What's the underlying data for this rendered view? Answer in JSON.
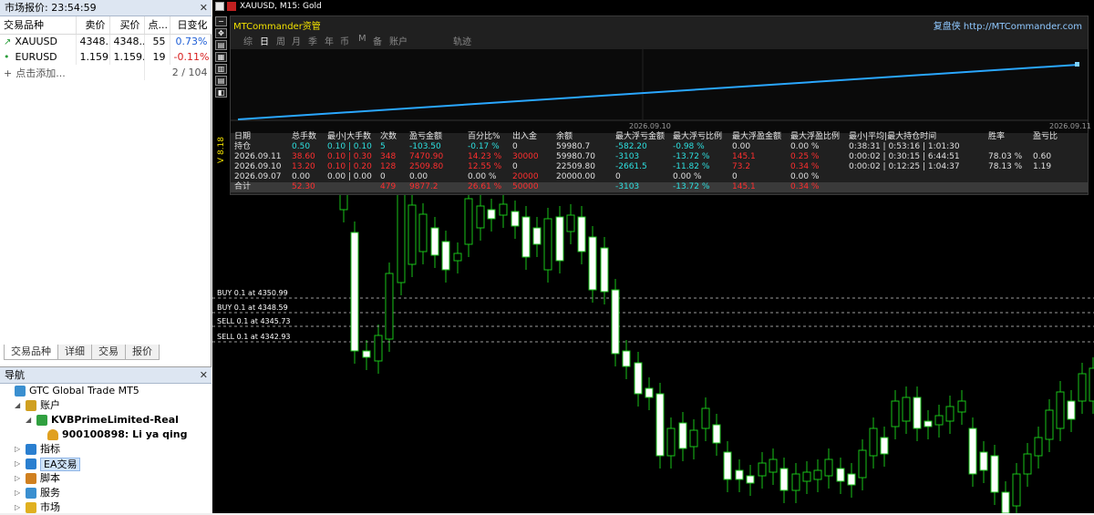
{
  "market_watch": {
    "title": "市场报价: 23:54:59",
    "columns": [
      "交易品种",
      "卖价",
      "买价",
      "点...",
      "日变化"
    ],
    "rows": [
      {
        "symbol": "XAUUSD",
        "bid": "4348...",
        "ask": "4348...",
        "spread": "55",
        "change": "0.73%",
        "dir": "up"
      },
      {
        "symbol": "EURUSD",
        "bid": "1.159...",
        "ask": "1.159...",
        "spread": "19",
        "change": "-0.11%",
        "dir": "down"
      }
    ],
    "add_label": "点击添加...",
    "count": "2 / 104",
    "tabs": [
      "交易品种",
      "详细",
      "交易",
      "报价"
    ]
  },
  "navigator": {
    "title": "导航",
    "items": [
      {
        "label": "GTC Global Trade MT5",
        "level": 0,
        "icon": "terminal-icon"
      },
      {
        "label": "账户",
        "level": 1,
        "icon": "accounts-icon",
        "expand": "expanded"
      },
      {
        "label": "KVBPrimeLimited-Real",
        "level": 2,
        "icon": "server-icon",
        "expand": "expanded",
        "bold": true
      },
      {
        "label": "900100898: Li ya qing",
        "level": 3,
        "icon": "user-icon",
        "bold": true
      },
      {
        "label": "指标",
        "level": 1,
        "icon": "indicator-icon",
        "expand": "collapsed"
      },
      {
        "label": "EA交易",
        "level": 1,
        "icon": "expert-icon",
        "expand": "collapsed",
        "selected": true
      },
      {
        "label": "脚本",
        "level": 1,
        "icon": "script-icon",
        "expand": "collapsed"
      },
      {
        "label": "服务",
        "level": 1,
        "icon": "service-icon",
        "expand": "collapsed"
      },
      {
        "label": "市场",
        "level": 1,
        "icon": "market-icon",
        "expand": "collapsed"
      }
    ]
  },
  "chart": {
    "title": "XAUUSD, M15:  Gold",
    "orders": [
      {
        "label": "BUY 0.1 at 4350.99"
      },
      {
        "label": "BUY 0.1 at 4348.59"
      },
      {
        "label": "SELL 0.1 at 4345.73"
      },
      {
        "label": "SELL 0.1 at 4342.93"
      }
    ]
  },
  "ea_panel": {
    "brand": "MTCommander资管",
    "link": "复盘侠 http://MTCommander.com",
    "version": "V 8.18",
    "tabs": [
      "综",
      "日",
      "周",
      "月",
      "季",
      "年",
      "币",
      "M",
      "备",
      "账户",
      "轨迹"
    ],
    "active_tab": "日",
    "equity_dates": [
      "2026.09.10",
      "2026.09.11"
    ],
    "headers": [
      "日期",
      "总手数",
      "最小|大手数",
      "次数",
      "盈亏金额",
      "百分比%",
      "出入金",
      "余额",
      "最大浮亏金额",
      "最大浮亏比例",
      "最大浮盈金额",
      "最大浮盈比例",
      "最小|平均|最大持仓时间",
      "胜率",
      "盈亏比"
    ],
    "rows": [
      {
        "cells": [
          "持仓",
          "0.50",
          "0.10 | 0.10",
          "5",
          "-103.50",
          "-0.17 %",
          "0",
          "59980.7",
          "-582.20",
          "-0.98 %",
          "0.00",
          "0.00 %",
          "0:38:31 | 0:53:16 | 1:01:30",
          "",
          ""
        ],
        "colors": [
          "w",
          "c",
          "c",
          "c",
          "c",
          "c",
          "w",
          "w",
          "c",
          "c",
          "w",
          "w",
          "w",
          "w",
          "w"
        ]
      },
      {
        "cells": [
          "2026.09.11",
          "38.60",
          "0.10 | 0.30",
          "348",
          "7470.90",
          "14.23 %",
          "30000",
          "59980.70",
          "-3103",
          "-13.72 %",
          "145.1",
          "0.25 %",
          "0:00:02 | 0:30:15 | 6:44:51",
          "78.03 %",
          "0.60"
        ],
        "colors": [
          "w",
          "r",
          "r",
          "r",
          "r",
          "r",
          "r",
          "w",
          "c",
          "c",
          "r",
          "r",
          "w",
          "w",
          "w"
        ]
      },
      {
        "cells": [
          "2026.09.10",
          "13.20",
          "0.10 | 0.20",
          "128",
          "2509.80",
          "12.55 %",
          "0",
          "22509.80",
          "-2661.5",
          "-11.82 %",
          "73.2",
          "0.34 %",
          "0:00:02 | 0:12:25 | 1:04:37",
          "78.13 %",
          "1.19"
        ],
        "colors": [
          "w",
          "r",
          "r",
          "r",
          "r",
          "r",
          "w",
          "w",
          "c",
          "c",
          "r",
          "r",
          "w",
          "w",
          "w"
        ]
      },
      {
        "cells": [
          "2026.09.07",
          "0.00",
          "0.00 | 0.00",
          "0",
          "0.00",
          "0.00 %",
          "20000",
          "20000.00",
          "0",
          "0.00 %",
          "0",
          "0.00 %",
          "",
          "",
          ""
        ],
        "colors": [
          "w",
          "w",
          "w",
          "w",
          "w",
          "w",
          "r",
          "w",
          "w",
          "w",
          "w",
          "w",
          "w",
          "w",
          "w"
        ]
      },
      {
        "cells": [
          "合计",
          "52.30",
          "",
          "479",
          "9877.2",
          "26.61 %",
          "50000",
          "",
          "-3103",
          "-13.72 %",
          "145.1",
          "0.34 %",
          "",
          "",
          ""
        ],
        "colors": [
          "w",
          "r",
          "w",
          "r",
          "r",
          "r",
          "r",
          "w",
          "c",
          "c",
          "r",
          "r",
          "w",
          "w",
          "w"
        ]
      }
    ]
  }
}
